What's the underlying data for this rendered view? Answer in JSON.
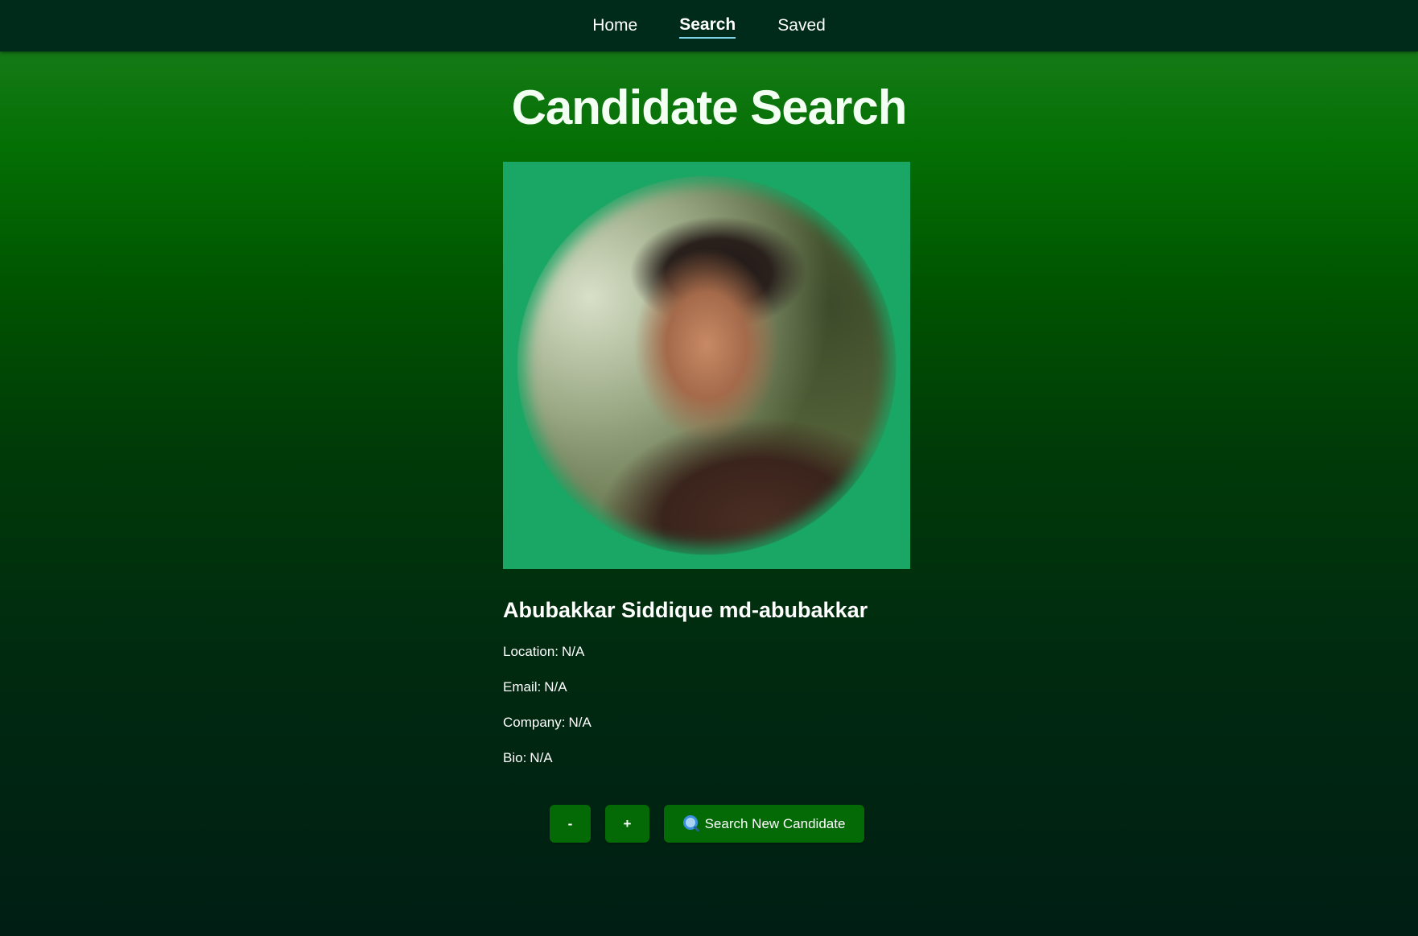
{
  "nav": {
    "items": [
      {
        "label": "Home",
        "active": false
      },
      {
        "label": "Search",
        "active": true
      },
      {
        "label": "Saved",
        "active": false
      }
    ]
  },
  "page": {
    "title": "Candidate Search"
  },
  "candidate": {
    "name": "Abubakkar Siddique md-abubakkar",
    "location_label": "Location:",
    "location_value": "N/A",
    "email_label": "Email:",
    "email_value": "N/A",
    "company_label": "Company:",
    "company_value": "N/A",
    "bio_label": "Bio:",
    "bio_value": "N/A"
  },
  "actions": {
    "minus_label": "-",
    "plus_label": "+",
    "search_label": "Search New Candidate",
    "search_icon": "magnifier-icon"
  },
  "colors": {
    "nav_bg": "#002a1a",
    "avatar_bg": "#1aa664",
    "button_bg": "#046a06",
    "active_underline": "#7fd3e6"
  }
}
